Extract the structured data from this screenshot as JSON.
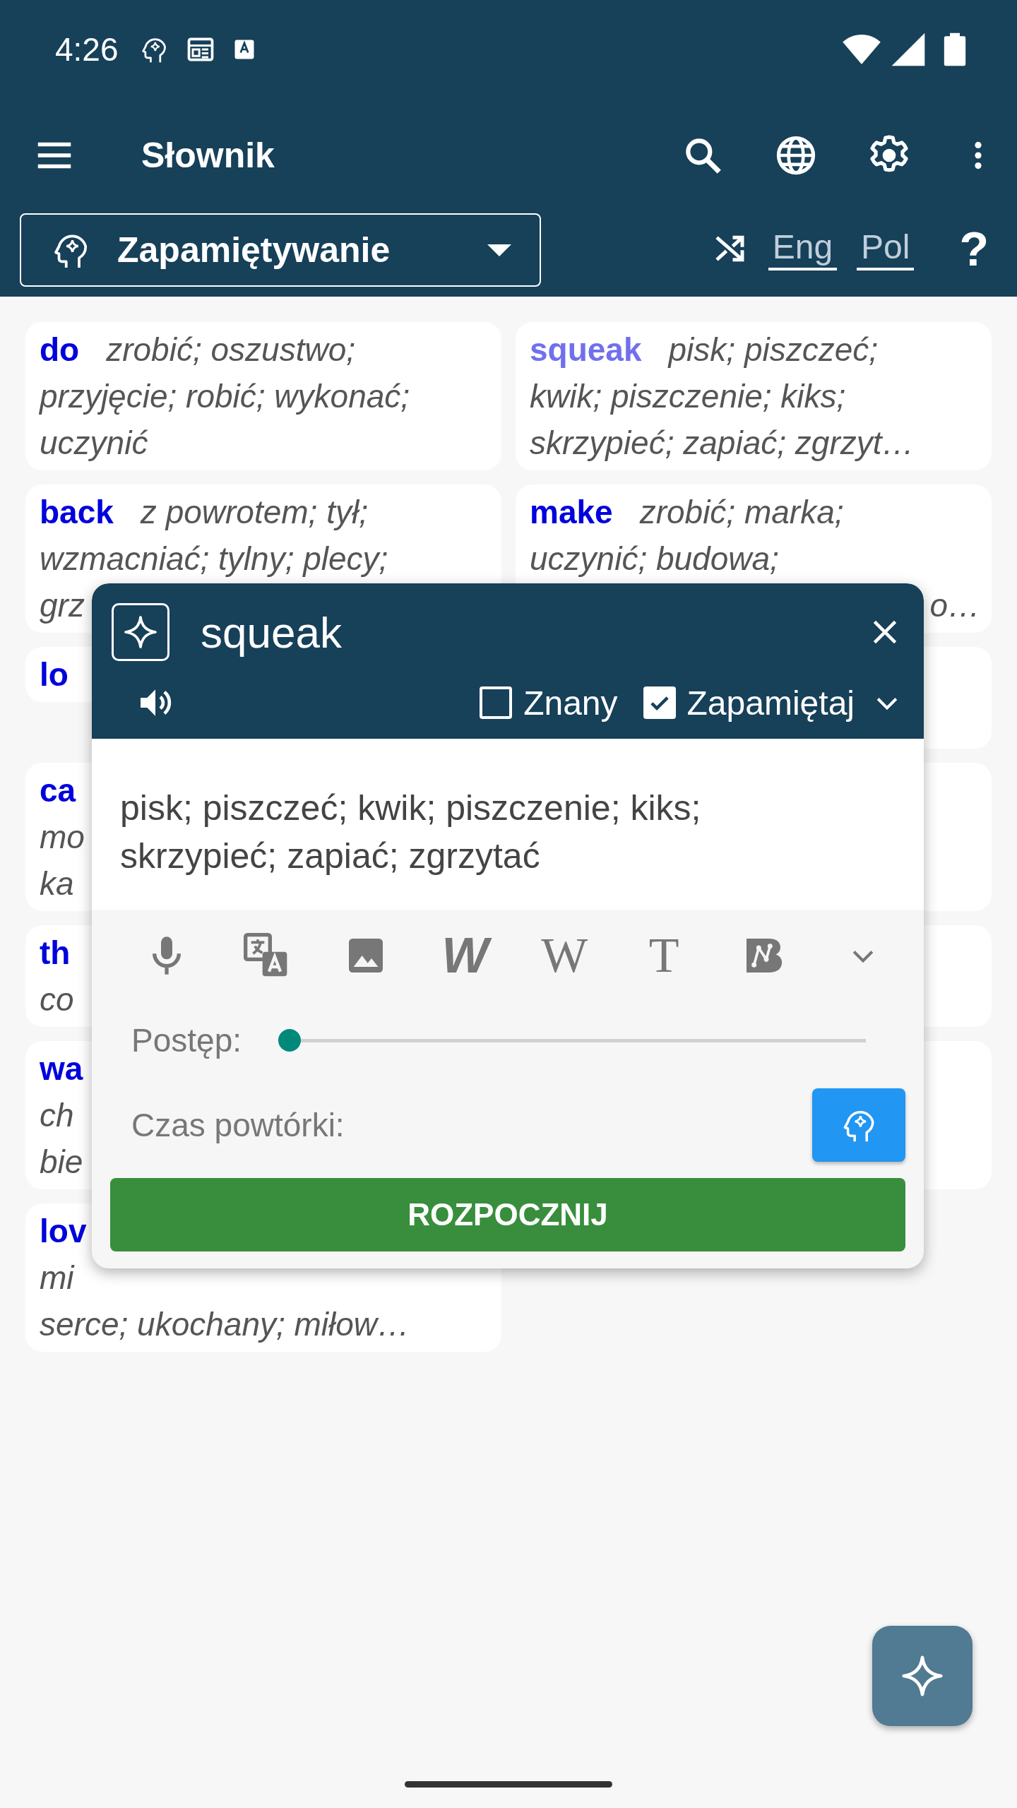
{
  "status_bar": {
    "time": "4:26"
  },
  "app_bar": {
    "title": "Słownik"
  },
  "filter": {
    "mode": "Zapamiętywanie",
    "languages": [
      {
        "label": "Eng"
      },
      {
        "label": "Pol"
      }
    ],
    "help": "?"
  },
  "cards": [
    {
      "word": "do",
      "selected": false,
      "translation": "zrobić; oszustwo;",
      "lines": [
        "przyjęcie; robić; wykonać;",
        "uczynić"
      ]
    },
    {
      "word": "squeak",
      "selected": true,
      "translation": "pisk; piszczeć;",
      "lines": [
        "kwik; piszczenie; kiks;",
        "skrzypieć; zapiać; zgrzyt…"
      ]
    },
    {
      "word": "back",
      "selected": false,
      "translation": "z powrotem; tył;",
      "lines": [
        "wzmacniać; tylny; plecy;",
        "grz"
      ]
    },
    {
      "word": "make",
      "selected": false,
      "translation": "zrobić; marka;",
      "lines": [
        "uczynić; budowa;"
      ],
      "tail": "o…"
    },
    {
      "word": "lo",
      "selected": false
    },
    {
      "covered": true
    },
    {
      "word": "ca",
      "selected": false,
      "lines": [
        "mo",
        "ka"
      ]
    },
    {
      "covered": true
    },
    {
      "word": "th",
      "selected": false,
      "lines": [
        "co"
      ]
    },
    {
      "covered": true
    },
    {
      "word": "wa",
      "selected": false,
      "lines": [
        "ch",
        "bie"
      ]
    },
    {
      "covered": true
    },
    {
      "word": "lov",
      "selected": false,
      "lines": [
        "mi",
        "serce; ukochany; miłow…"
      ]
    }
  ],
  "popup": {
    "word": "squeak",
    "options": [
      {
        "label": "Znany",
        "checked": false
      },
      {
        "label": "Zapamiętaj",
        "checked": true
      }
    ],
    "translation": "pisk; piszczeć; kwik; piszczenie; kiks; skrzypieć; zapiać; zgrzytać",
    "tools": [
      {
        "kind": "mic"
      },
      {
        "kind": "translate"
      },
      {
        "kind": "image"
      },
      {
        "kind": "glyph-bold",
        "text": "W"
      },
      {
        "kind": "glyph-serif",
        "text": "W"
      },
      {
        "kind": "glyph-serif",
        "text": "T"
      },
      {
        "kind": "graph"
      },
      {
        "kind": "more"
      }
    ],
    "progress": {
      "label": "Postęp:",
      "level": 0
    },
    "review": {
      "label": "Czas powtórki:"
    },
    "start_button": "ROZPOCZNIJ"
  }
}
